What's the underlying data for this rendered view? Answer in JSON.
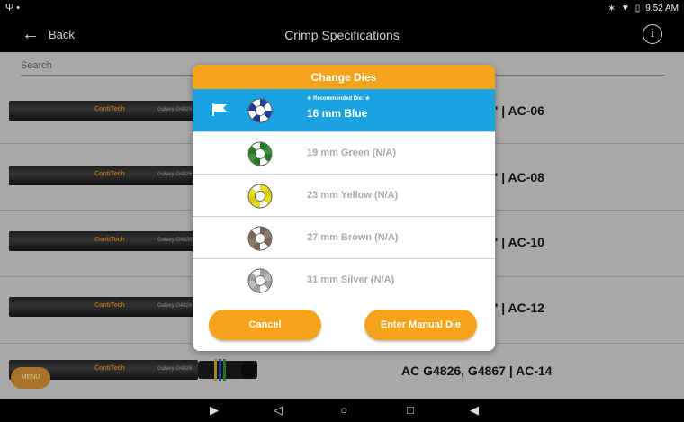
{
  "status_bar": {
    "left_icons": "Ψ •",
    "time": "9:52 AM"
  },
  "app_bar": {
    "back_label": "Back",
    "title": "Crimp Specifications"
  },
  "search": {
    "placeholder": "Search"
  },
  "hoses": [
    {
      "brand": "ContiTech",
      "model": "Galaxy G4826",
      "label": "' | AC-06"
    },
    {
      "brand": "ContiTech",
      "model": "Galaxy G4826",
      "label": "' | AC-08"
    },
    {
      "brand": "ContiTech",
      "model": "Galaxy G4826",
      "label": "' | AC-10"
    },
    {
      "brand": "ContiTech",
      "model": "Galaxy G4826",
      "label": "' | AC-12"
    },
    {
      "brand": "ContiTech",
      "model": "Galaxy G4826",
      "label": "AC G4826, G4867 | AC-14"
    }
  ],
  "menu_label": "MENU",
  "modal": {
    "title": "Change Dies",
    "recommended_label": "★ Recommended Die: ★",
    "dies": [
      {
        "label": "16 mm Blue",
        "color": "#1b3a9c",
        "selected": true
      },
      {
        "label": "19 mm Green (N/A)",
        "color": "#1f7a1f",
        "selected": false
      },
      {
        "label": "23 mm Yellow (N/A)",
        "color": "#e8dc1a",
        "selected": false
      },
      {
        "label": "27 mm Brown (N/A)",
        "color": "#7a6655",
        "selected": false
      },
      {
        "label": "31 mm Silver (N/A)",
        "color": "#a0a0a0",
        "selected": false
      }
    ],
    "cancel_label": "Cancel",
    "manual_label": "Enter Manual Die"
  },
  "colors": {
    "accent": "#f5a31a",
    "selected": "#1aa3e1"
  }
}
